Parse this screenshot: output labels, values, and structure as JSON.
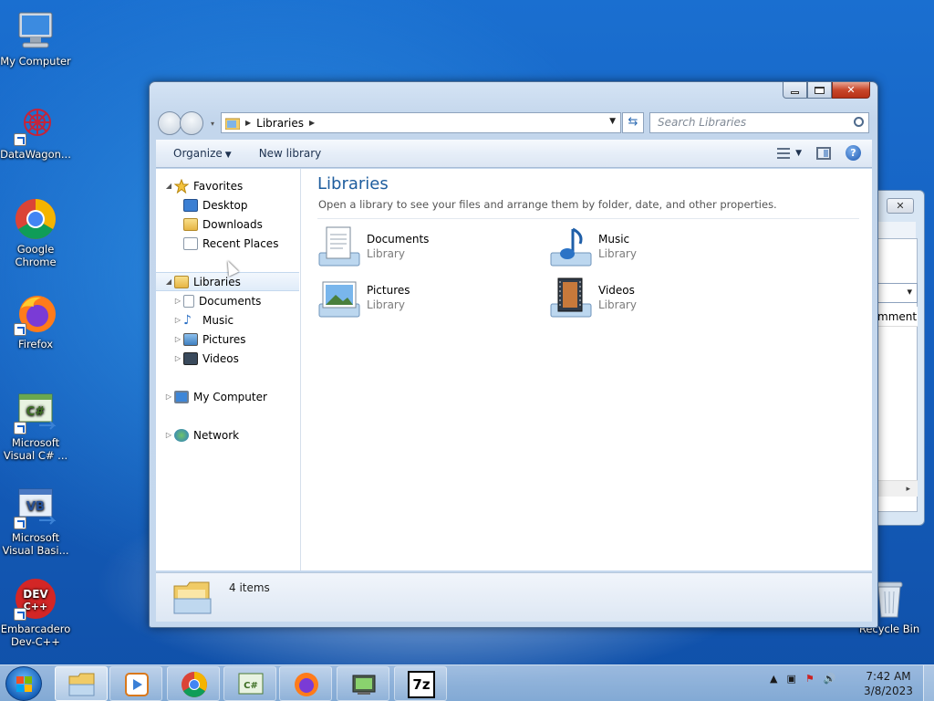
{
  "desktop": {
    "icons": [
      {
        "label": "My Computer",
        "icon": "computer-icon"
      },
      {
        "label": "DataWagon...",
        "icon": "datawagon-icon"
      },
      {
        "label": "Google Chrome",
        "icon": "chrome-icon"
      },
      {
        "label": "Firefox",
        "icon": "firefox-icon"
      },
      {
        "label": "Microsoft Visual C# ...",
        "icon": "visual-csharp-icon"
      },
      {
        "label": "Microsoft Visual Basi...",
        "icon": "visual-basic-icon"
      },
      {
        "label": "Embarcadero Dev-C++",
        "icon": "devcpp-icon"
      },
      {
        "label": "Recycle Bin",
        "icon": "recycle-bin-icon"
      }
    ]
  },
  "background_dialog": {
    "close": "✕",
    "column_header": "mment"
  },
  "explorer": {
    "caption_buttons": {
      "close": "✕"
    },
    "address": {
      "crumbs": [
        "Libraries"
      ]
    },
    "search": {
      "placeholder": "Search Libraries"
    },
    "toolbar": {
      "organize": "Organize",
      "new_library": "New library",
      "help": "?"
    },
    "nav": {
      "favorites": "Favorites",
      "favorites_items": [
        "Desktop",
        "Downloads",
        "Recent Places"
      ],
      "libraries": "Libraries",
      "libraries_items": [
        "Documents",
        "Music",
        "Pictures",
        "Videos"
      ],
      "computer": "My Computer",
      "network": "Network"
    },
    "main": {
      "title": "Libraries",
      "subtitle": "Open a library to see your files and arrange them by folder, date, and other properties.",
      "libraries": [
        {
          "name": "Documents",
          "kind": "Library",
          "icon": "documents-library-icon"
        },
        {
          "name": "Music",
          "kind": "Library",
          "icon": "music-library-icon"
        },
        {
          "name": "Pictures",
          "kind": "Library",
          "icon": "pictures-library-icon"
        },
        {
          "name": "Videos",
          "kind": "Library",
          "icon": "videos-library-icon"
        }
      ]
    },
    "status": {
      "count": "4 items"
    }
  },
  "taskbar": {
    "apps": [
      {
        "name": "Windows Explorer",
        "icon": "explorer-icon",
        "active": true
      },
      {
        "name": "Media Player",
        "icon": "media-player-icon",
        "active": false
      },
      {
        "name": "Google Chrome",
        "icon": "chrome-icon",
        "active": false
      },
      {
        "name": "Visual C#",
        "icon": "visual-csharp-icon",
        "active": false
      },
      {
        "name": "Firefox",
        "icon": "firefox-icon",
        "active": false
      },
      {
        "name": "Device App",
        "icon": "device-icon",
        "active": false
      },
      {
        "name": "7-Zip",
        "icon": "7zip-icon",
        "label": "7z",
        "active": false
      }
    ],
    "clock": {
      "time": "7:42 AM",
      "date": "3/8/2023"
    }
  },
  "colors": {
    "accent_title": "#1e5d9e",
    "desktop_blue": "#1560c0"
  }
}
